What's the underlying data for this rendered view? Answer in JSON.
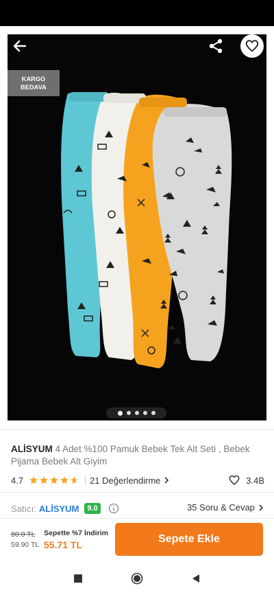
{
  "header": {
    "back_icon": "arrow-left-icon",
    "share_icon": "share-icon",
    "favorite_icon": "heart-outline-icon"
  },
  "badge": {
    "line1": "KARGO",
    "line2": "BEDAVA"
  },
  "gallery": {
    "image_count": 5,
    "active_index": 0
  },
  "product": {
    "brand": "ALİSYUM",
    "name": " 4 Adet %100 Pamuk Bebek Tek Alt Seti , Bebek Pijama Bebek Alt Giyim"
  },
  "rating": {
    "score": "4.7",
    "stars": 4.7,
    "reviews": "21 Değerlendirme",
    "likes": "3.4B"
  },
  "seller": {
    "label": "Satıcı:",
    "name": "ALİSYUM",
    "score": "9.0",
    "qa": "35 Soru & Cevap"
  },
  "price": {
    "old": "80.0 TL",
    "current": "59.90 TL",
    "discount_label": "Sepette %7 İndirim",
    "discounted": "55.71 TL"
  },
  "cart_button": "Sepete Ekle",
  "colors": {
    "accent": "#f27a1a",
    "link": "#2b7de1",
    "score_bg": "#2fb34a",
    "star": "#f5a623"
  }
}
